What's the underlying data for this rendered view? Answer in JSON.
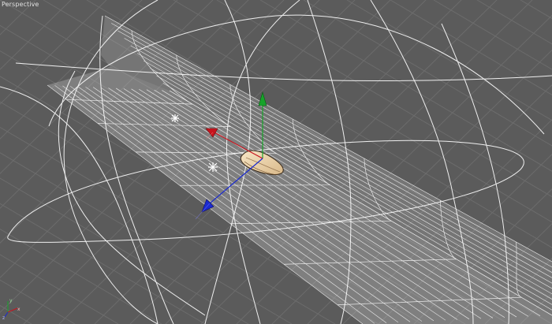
{
  "viewport": {
    "label": "Perspective",
    "background": "#5b5b5b",
    "grid_color": "#6c6c6c",
    "wire_color": "#ffffff"
  },
  "gizmo": {
    "x_color": "#c8141e",
    "y_color": "#17a42a",
    "z_color": "#1a2ad0"
  },
  "axis_tripod": {
    "x": "x",
    "y": "y",
    "z": "z"
  }
}
